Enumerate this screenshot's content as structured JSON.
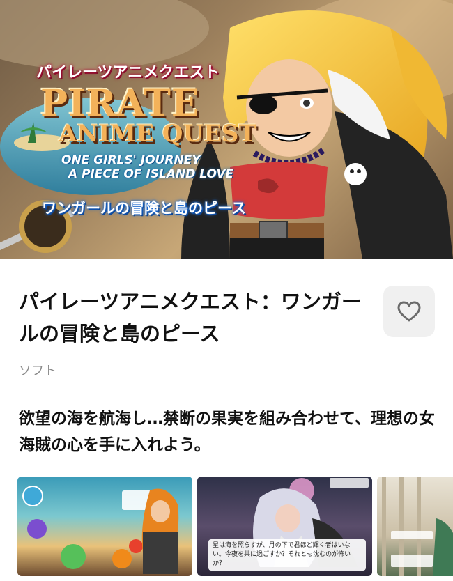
{
  "hero": {
    "jp_title": "パイレーツアニメクエスト",
    "logo_line1": "PIRATE",
    "logo_line2": "ANIME QUEST",
    "subtitle_line1": "ONE GIRLS' JOURNEY",
    "subtitle_line2": "A PIECE OF ISLAND LOVE",
    "jp_subtitle": "ワンガールの冒険と島のピース"
  },
  "product": {
    "title": "パイレーツアニメクエスト：ワンガールの冒険と島のピース",
    "category": "ソフト",
    "description": "欲望の海を航海し…禁断の果実を組み合わせて、理想の女海賊の心を手に入れよう。"
  },
  "favorite": {
    "icon": "heart-icon"
  },
  "screenshots": [
    {
      "caption": ""
    },
    {
      "caption": "星は海を照らすが、月の下で君ほど輝く者はいない。今夜を共に過ごすか？それとも沈むのが怖いか？"
    },
    {
      "caption": ""
    }
  ],
  "colors": {
    "background": "#ffffff",
    "title_text": "#111111",
    "category_text": "#8a8a8a",
    "favorite_bg": "#f0f0f0",
    "heart": "#6b6b6b"
  }
}
